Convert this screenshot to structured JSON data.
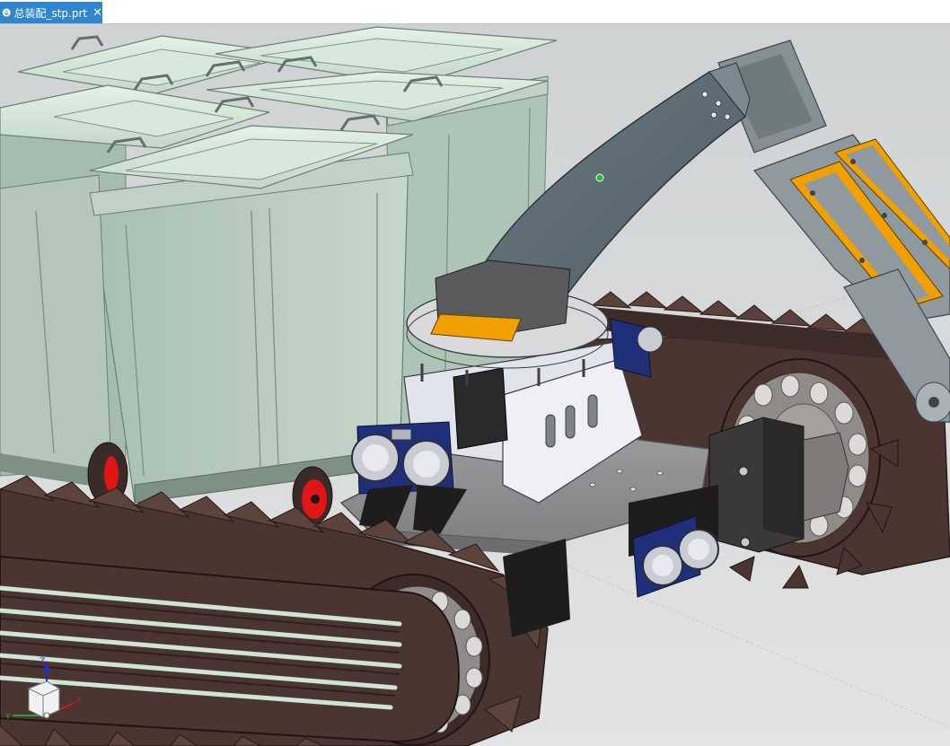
{
  "tab": {
    "label": "总装配_stp.prt",
    "icon": "part-file-icon",
    "close_icon": "close-icon"
  },
  "viewport": {
    "background": "#d4d6d6",
    "content": "3d-assembly-model"
  },
  "triad": {
    "x_label": "X",
    "y_label": "Y",
    "z_label": "Z"
  },
  "colors": {
    "tab_active": "#2f86cf",
    "bin_body": "#b7ccc0",
    "bin_lid": "#cfe3d6",
    "track": "#4a3530",
    "plate": "#8f9192",
    "arm": "#5b6a73",
    "accent_orange": "#f0a000",
    "sensor_blue": "#1f2f7a",
    "wheel_red": "#e01515"
  }
}
